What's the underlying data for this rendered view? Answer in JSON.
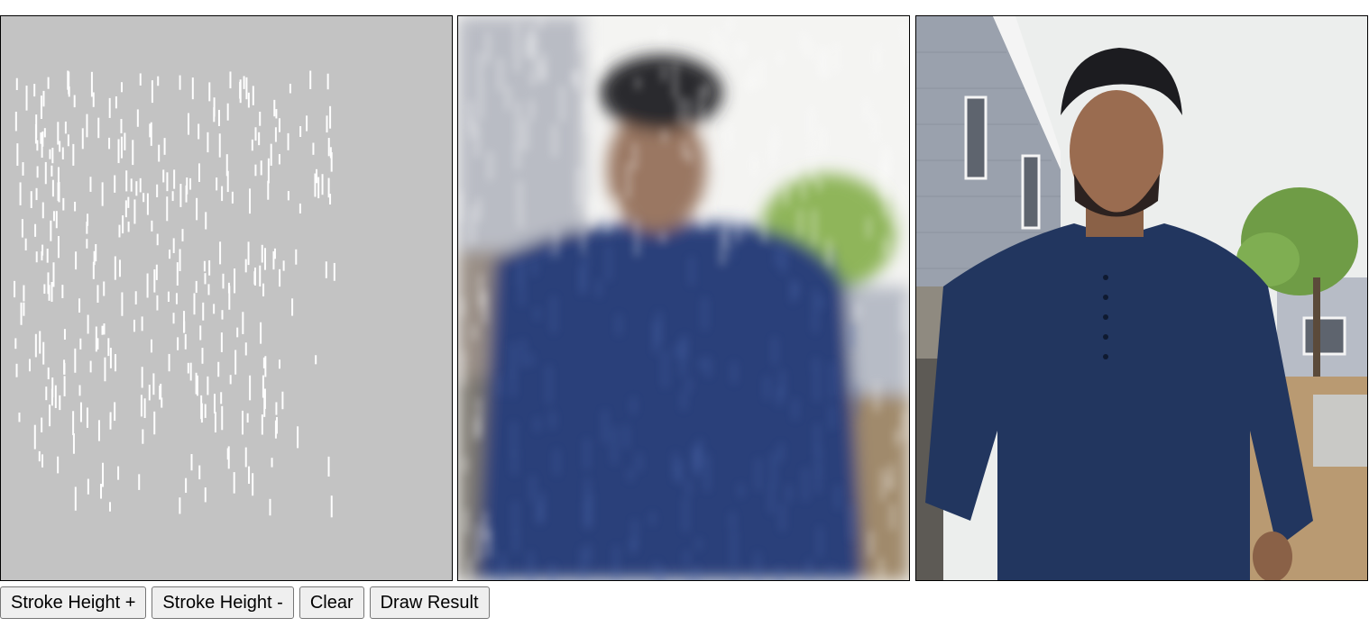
{
  "panels": {
    "stroke_canvas": {
      "background": "#c3c3c3",
      "stroke_color": "#ffffff"
    },
    "result_canvas": {
      "description_colors": {
        "shirt": "#2b3f7a",
        "sky": "#f0f0ee",
        "tree": "#8fb55a"
      }
    },
    "original_image": {
      "colors": {
        "shirt": "#22365f",
        "siding": "#9aa1ad",
        "sky": "#eceeed",
        "tree": "#6f9c46",
        "ground": "#b99a72"
      }
    }
  },
  "buttons": {
    "stroke_height_plus": "Stroke Height +",
    "stroke_height_minus": "Stroke Height -",
    "clear": "Clear",
    "draw_result": "Draw Result"
  }
}
